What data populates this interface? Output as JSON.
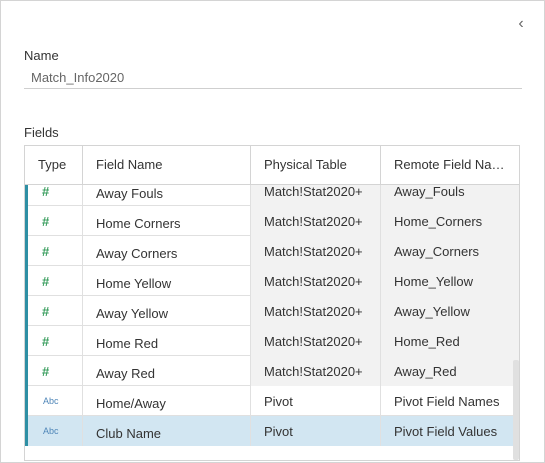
{
  "panel": {
    "collapse_glyph": "‹",
    "name_label": "Name",
    "name_value": "Match_Info2020",
    "fields_label": "Fields"
  },
  "columns": [
    "Type",
    "Field Name",
    "Physical Table",
    "Remote Field Na…"
  ],
  "rows": [
    {
      "type": "number",
      "icon": "#",
      "field_name": "Away Fouls",
      "physical_table": "Match!Stat2020+",
      "remote_field": "Away_Fouls"
    },
    {
      "type": "number",
      "icon": "#",
      "field_name": "Home Corners",
      "physical_table": "Match!Stat2020+",
      "remote_field": "Home_Corners"
    },
    {
      "type": "number",
      "icon": "#",
      "field_name": "Away Corners",
      "physical_table": "Match!Stat2020+",
      "remote_field": "Away_Corners"
    },
    {
      "type": "number",
      "icon": "#",
      "field_name": "Home Yellow",
      "physical_table": "Match!Stat2020+",
      "remote_field": "Home_Yellow"
    },
    {
      "type": "number",
      "icon": "#",
      "field_name": "Away Yellow",
      "physical_table": "Match!Stat2020+",
      "remote_field": "Away_Yellow"
    },
    {
      "type": "number",
      "icon": "#",
      "field_name": "Home Red",
      "physical_table": "Match!Stat2020+",
      "remote_field": "Home_Red"
    },
    {
      "type": "number",
      "icon": "#",
      "field_name": "Away Red",
      "physical_table": "Match!Stat2020+",
      "remote_field": "Away_Red"
    },
    {
      "type": "string",
      "icon": "Abc",
      "field_name": "Home/Away",
      "physical_table": "Pivot",
      "remote_field": "Pivot Field Names"
    },
    {
      "type": "string",
      "icon": "Abc",
      "field_name": "Club Name",
      "physical_table": "Pivot",
      "remote_field": "Pivot Field Values"
    }
  ],
  "selected_row": 8,
  "colors": {
    "accent_bar": "#2e8fa4",
    "number_icon": "#3a9e5f",
    "string_icon": "#4f86b8",
    "selected_row_bg": "#d2e6f2",
    "shaded_cell_bg": "#f2f2f2"
  }
}
